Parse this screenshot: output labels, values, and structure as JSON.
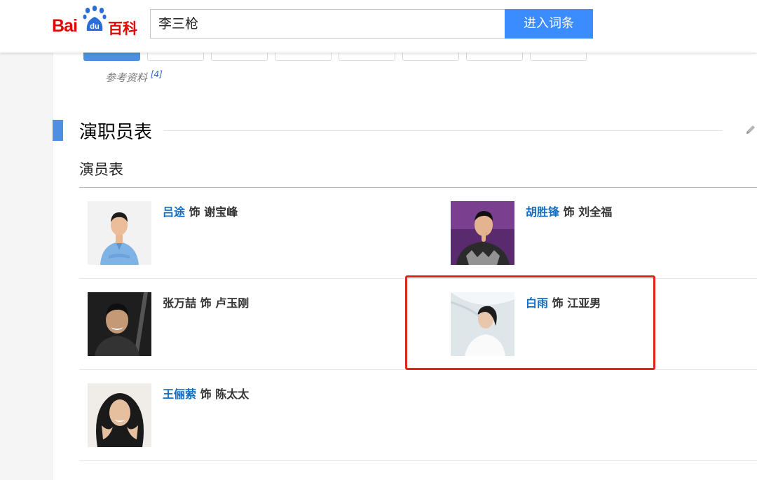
{
  "header": {
    "logo_text": "Bai百科",
    "logo_du": "du",
    "logo_bai": "Bai",
    "logo_baike": "百科",
    "search_value": "李三枪",
    "search_button": "进入词条"
  },
  "reference": {
    "label": "参考资料",
    "note": "[4]"
  },
  "section": {
    "title": "演职员表",
    "subtitle": "演员表"
  },
  "cast": [
    {
      "actor": "吕途",
      "role_prefix": "饰",
      "role": "谢宝峰",
      "linked": true
    },
    {
      "actor": "胡胜锋",
      "role_prefix": "饰",
      "role": "刘全福",
      "linked": true
    },
    {
      "actor": "张万喆",
      "role_prefix": "饰",
      "role": "卢玉刚",
      "linked": false
    },
    {
      "actor": "白雨",
      "role_prefix": "饰",
      "role": "江亚男",
      "linked": true
    },
    {
      "actor": "王俪萦",
      "role_prefix": "饰",
      "role": "陈太太",
      "linked": true
    }
  ],
  "colors": {
    "brand_red": "#e10602",
    "search_blue": "#3b8cff",
    "link_blue": "#136ec2",
    "section_bar": "#4d8fe0",
    "highlight_red": "#e0241b"
  }
}
